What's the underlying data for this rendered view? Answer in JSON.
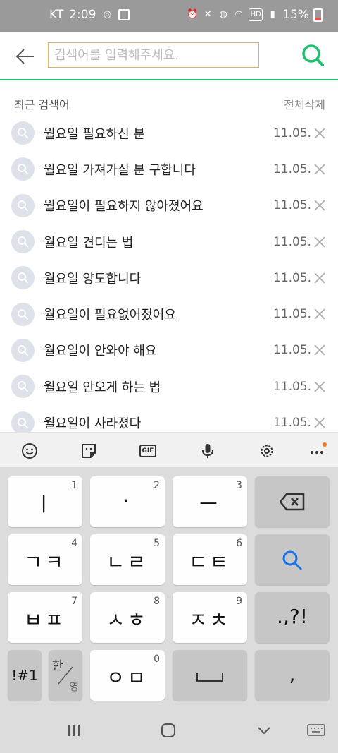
{
  "status_bar": {
    "carrier": "KT",
    "time": "2:09",
    "battery": "15%"
  },
  "search": {
    "placeholder": "검색어를 입력해주세요.",
    "value": ""
  },
  "recent": {
    "title": "최근 검색어",
    "delete_all": "전체삭제",
    "items": [
      {
        "text": "월요일 필요하신 분",
        "date": "11.05."
      },
      {
        "text": "월요일 가져가실 분 구합니다",
        "date": "11.05."
      },
      {
        "text": "월요일이 필요하지 않아졌어요",
        "date": "11.05."
      },
      {
        "text": "월요일 견디는 법",
        "date": "11.05."
      },
      {
        "text": "월요일 양도합니다",
        "date": "11.05."
      },
      {
        "text": "월요일이 필요없어졌어요",
        "date": "11.05."
      },
      {
        "text": "월요일이 안와야 해요",
        "date": "11.05."
      },
      {
        "text": "월요일 안오게 하는 법",
        "date": "11.05."
      },
      {
        "text": "월요일이 사라졌다",
        "date": "11.05."
      }
    ]
  },
  "keyboard": {
    "toolbar": [
      "emoji-icon",
      "sticker-icon",
      "gif-icon",
      "microphone-icon",
      "settings-icon",
      "more-icon"
    ],
    "gif_label": "GIF",
    "keys": [
      {
        "main": "ㅣ",
        "num": "1"
      },
      {
        "main": "·",
        "num": "2"
      },
      {
        "main": "ㅡ",
        "num": "3"
      },
      {
        "main": "ㄱㅋ",
        "num": "4"
      },
      {
        "main": "ㄴㄹ",
        "num": "5"
      },
      {
        "main": "ㄷㅌ",
        "num": "6"
      },
      {
        "main": "ㅂㅍ",
        "num": "7"
      },
      {
        "main": "ㅅㅎ",
        "num": "8"
      },
      {
        "main": "ㅈㅊ",
        "num": "9"
      },
      {
        "main": "ㅇㅁ",
        "num": "0"
      }
    ],
    "punct_label": ".,?!",
    "symbols_label": "!#1",
    "lang_top": "한",
    "lang_bottom": "영",
    "comma_label": ","
  },
  "colors": {
    "accent": "#1fc16e",
    "input_border": "#d8b56e",
    "notification_dot": "#f07a22"
  }
}
